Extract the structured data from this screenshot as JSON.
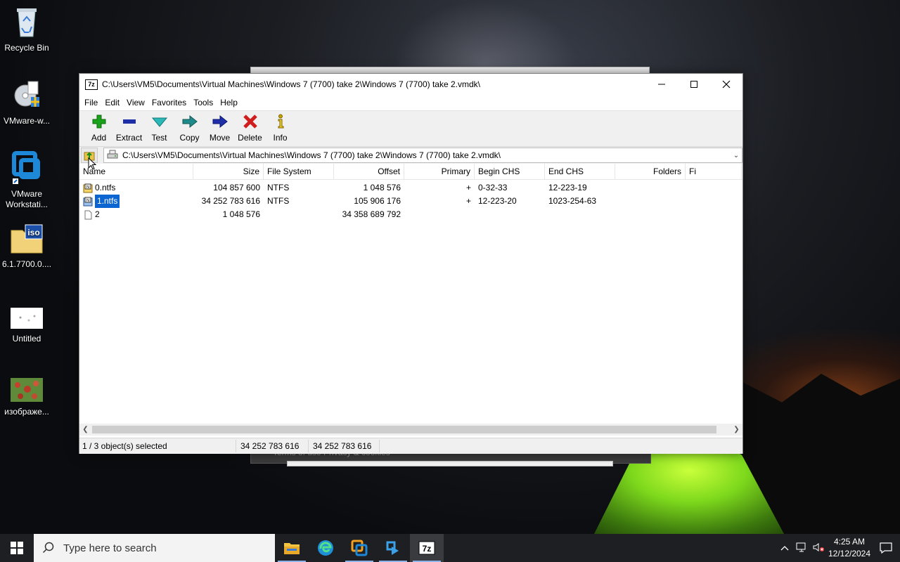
{
  "desktop": {
    "icons": [
      {
        "label": "Recycle Bin"
      },
      {
        "label": "VMware-w..."
      },
      {
        "label": "VMware Workstati..."
      },
      {
        "label": "6.1.7700.0...."
      },
      {
        "label": "Untitled"
      },
      {
        "label": "изображе..."
      }
    ],
    "background_footer_text": "Terms of use    Privacy & cookies"
  },
  "window": {
    "title": "C:\\Users\\VM5\\Documents\\Virtual Machines\\Windows 7 (7700) take 2\\Windows 7 (7700) take 2.vmdk\\",
    "app_icon_label": "7z",
    "menu": [
      "File",
      "Edit",
      "View",
      "Favorites",
      "Tools",
      "Help"
    ],
    "toolbar": [
      {
        "label": "Add",
        "icon": "plus-icon",
        "color": "#1aa31a"
      },
      {
        "label": "Extract",
        "icon": "minus-icon",
        "color": "#1f2fa8"
      },
      {
        "label": "Test",
        "icon": "check-icon",
        "color": "#2ab8b8"
      },
      {
        "label": "Copy",
        "icon": "copy-arrow-icon",
        "color": "#1f8a8a"
      },
      {
        "label": "Move",
        "icon": "move-arrow-icon",
        "color": "#1f2fa8"
      },
      {
        "label": "Delete",
        "icon": "x-icon",
        "color": "#d01e1e"
      },
      {
        "label": "Info",
        "icon": "info-icon",
        "color": "#c9a200"
      }
    ],
    "address": "C:\\Users\\VM5\\Documents\\Virtual Machines\\Windows 7 (7700) take 2\\Windows 7 (7700) take 2.vmdk\\",
    "columns": [
      "Name",
      "Size",
      "File System",
      "Offset",
      "Primary",
      "Begin CHS",
      "End CHS",
      "Folders",
      "Fi"
    ],
    "rows": [
      {
        "name": "0.ntfs",
        "size": "104 857 600",
        "fs": "NTFS",
        "offset": "1 048 576",
        "primary": "+",
        "begin": "0-32-33",
        "end": "12-223-19",
        "folders": "",
        "fi": "",
        "selected": false,
        "icon": "partition-icon"
      },
      {
        "name": "1.ntfs",
        "size": "34 252 783 616",
        "fs": "NTFS",
        "offset": "105 906 176",
        "primary": "+",
        "begin": "12-223-20",
        "end": "1023-254-63",
        "folders": "",
        "fi": "",
        "selected": true,
        "icon": "partition-icon"
      },
      {
        "name": "2",
        "size": "1 048 576",
        "fs": "",
        "offset": "34 358 689 792",
        "primary": "",
        "begin": "",
        "end": "",
        "folders": "",
        "fi": "",
        "selected": false,
        "icon": "blank-file-icon"
      }
    ],
    "status": {
      "selection": "1 / 3 object(s) selected",
      "size": "34 252 783 616",
      "packed": "34 252 783 616"
    }
  },
  "taskbar": {
    "search_placeholder": "Type here to search",
    "apps": [
      "file-explorer-icon",
      "edge-icon",
      "vmware-icon",
      "vmware-player-icon",
      "7zip-icon"
    ],
    "time": "4:25 AM",
    "date": "12/12/2024"
  },
  "colors": {
    "selection": "#0a64d2",
    "taskbar": "#1e1f22"
  }
}
